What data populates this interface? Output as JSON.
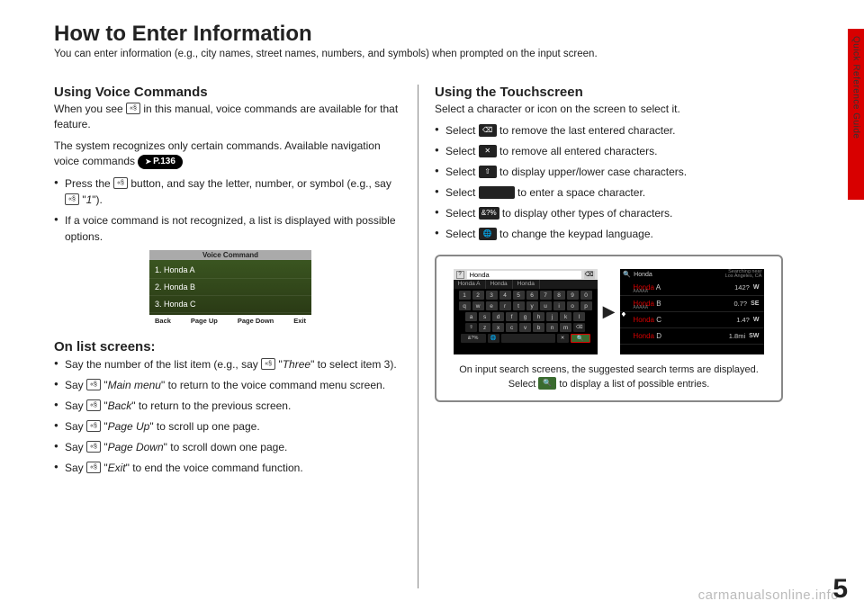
{
  "sideLabel": "Quick Reference Guide",
  "pageNumber": "5",
  "watermark": "carmanualsonline.info",
  "title": "How to Enter Information",
  "subtitle": "You can enter information (e.g., city names, street names, numbers, and symbols) when prompted on the input screen.",
  "left": {
    "voice": {
      "heading": "Using Voice Commands",
      "p1a": "When you see ",
      "p1b": " in this manual, voice commands are available for that feature.",
      "p2": "The system recognizes only certain commands. Available navigation voice commands ",
      "pageref": "P.136",
      "b1a": "Press the ",
      "b1b": " button, and say the letter, number, or symbol (e.g., say ",
      "b1c": " \"",
      "b1d": "1",
      "b1e": "\").",
      "b2": "If a voice command is not recognized, a list is displayed with possible options."
    },
    "vcShot": {
      "title": "Voice Command",
      "r1": "1. Honda A",
      "r2": "2. Honda B",
      "r3": "3. Honda C",
      "f1": "Back",
      "f2": "Page Up",
      "f3": "Page Down",
      "f4": "Exit"
    },
    "list": {
      "heading": "On list screens:",
      "b1a": "Say the number of the list item (e.g., say ",
      "b1b": " \"",
      "b1c": "Three",
      "b1d": "\" to select item 3).",
      "b2a": "Say ",
      "b2b": " \"",
      "b2c": "Main menu",
      "b2d": "\" to return to the voice command menu screen.",
      "b3a": "Say ",
      "b3b": " \"",
      "b3c": "Back",
      "b3d": "\" to return to the previous screen.",
      "b4a": "Say ",
      "b4b": " \"",
      "b4c": "Page Up",
      "b4d": "\" to scroll up one page.",
      "b5a": "Say ",
      "b5b": " \"",
      "b5c": "Page Down",
      "b5d": "\" to scroll down one page.",
      "b6a": "Say ",
      "b6b": " \"",
      "b6c": "Exit",
      "b6d": "\" to end the voice command function."
    }
  },
  "right": {
    "touch": {
      "heading": "Using the Touchscreen",
      "p1": "Select a character or icon on the screen to select it.",
      "b1a": "Select ",
      "b1b": " to remove the last entered character.",
      "i1": "⌫",
      "b2a": "Select ",
      "b2b": " to remove all entered characters.",
      "i2": "✕",
      "b3a": "Select ",
      "b3b": " to display upper/lower case characters.",
      "i3": "⇧",
      "b4a": "Select ",
      "b4b": " to enter a space character.",
      "i4": " ",
      "b5a": "Select ",
      "b5b": " to display other types of characters.",
      "i5": "&?%",
      "b6a": "Select ",
      "b6b": " to change the keypad language.",
      "i6": "🌐"
    },
    "fig": {
      "s1": {
        "q": "?",
        "field": "Honda",
        "bs": "⌫",
        "sug1": "Honda A",
        "sug2": "Honda",
        "sug3": "Honda",
        "row1": [
          "1",
          "2",
          "3",
          "4",
          "5",
          "6",
          "7",
          "8",
          "9",
          "0"
        ],
        "row2": [
          "q",
          "w",
          "e",
          "r",
          "t",
          "y",
          "u",
          "i",
          "o",
          "p"
        ],
        "row3": [
          "a",
          "s",
          "d",
          "f",
          "g",
          "h",
          "j",
          "k",
          "l"
        ],
        "shiftKey": "⇧",
        "row4": [
          "z",
          "x",
          "c",
          "v",
          "b",
          "n",
          "m"
        ],
        "bsKey": "⌫",
        "altKey": "&?%",
        "globeKey": "🌐",
        "clearKey": "✕",
        "searchKey": "🔍"
      },
      "s2": {
        "q": "🔍",
        "query": "Honda",
        "loc1": "Searching near",
        "loc2": "Los Angeles, CA",
        "rows": [
          {
            "hl": "Honda",
            "rest": " A",
            "sub": "AAAAA",
            "dist": "142?",
            "dir": "W"
          },
          {
            "hl": "Honda",
            "rest": " B",
            "sub": "AAAAA",
            "dist": "0.7?",
            "dir": "SE"
          },
          {
            "hl": "Honda",
            "rest": " C",
            "sub": "",
            "dist": "1.4?",
            "dir": "W"
          },
          {
            "hl": "Honda",
            "rest": " D",
            "sub": "",
            "dist": "1.8mi",
            "dir": "SW"
          }
        ]
      },
      "cap1": "On input search screens, the suggested search terms are displayed. Select ",
      "capIcon": "🔍",
      "cap2": " to display a list of possible entries."
    }
  }
}
